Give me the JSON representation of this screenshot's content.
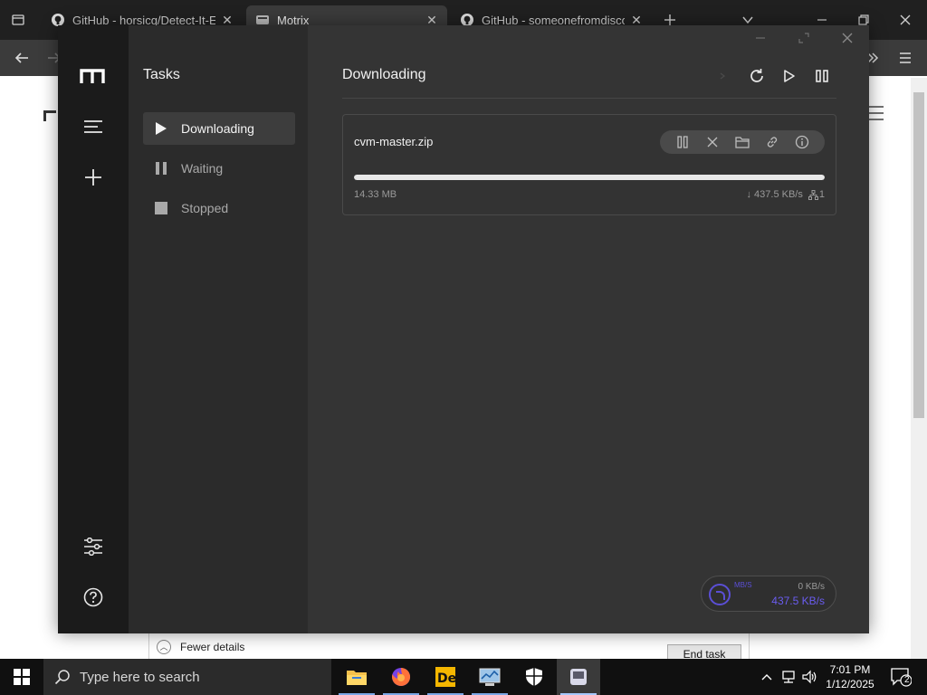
{
  "browser": {
    "tabs": [
      {
        "label": "GitHub - horsicq/Detect-It-Easy",
        "active": false
      },
      {
        "label": "Motrix",
        "active": true
      },
      {
        "label": "GitHub - someonefromdiscord",
        "active": false
      }
    ]
  },
  "task_manager_fragment": {
    "fewer_details": "Fewer details",
    "end_task": "End task"
  },
  "motrix": {
    "tasks_title": "Tasks",
    "task_filters": [
      {
        "label": "Downloading",
        "icon": "play-icon",
        "active": true
      },
      {
        "label": "Waiting",
        "icon": "pause-icon",
        "active": false
      },
      {
        "label": "Stopped",
        "icon": "stop-icon",
        "active": false
      }
    ],
    "main_title": "Downloading",
    "task": {
      "name": "cvm-master.zip",
      "size": "14.33 MB",
      "progress": 1.0,
      "speed": "437.5 KB/s",
      "connections": "1"
    },
    "speedometer": {
      "limit_label": "MB/S",
      "upload": "0 KB/s",
      "download": "437.5 KB/s"
    }
  },
  "taskbar": {
    "search_placeholder": "Type here to search",
    "time": "7:01 PM",
    "date": "1/12/2025",
    "notification_count": "2"
  },
  "colors": {
    "accent": "#5b4fd6",
    "progress_fill": "#e8e8e8",
    "sidebar": "#1b1b1b",
    "tasklist_bg": "#2b2b2b",
    "main_bg": "#343434"
  }
}
